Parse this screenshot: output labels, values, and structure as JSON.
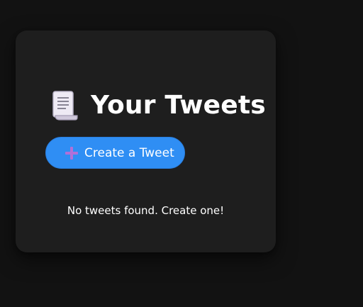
{
  "header": {
    "icon": "scroll-icon",
    "title": "Your Tweets"
  },
  "actions": {
    "create_icon": "plus-icon",
    "create_label": "Create a Tweet"
  },
  "content": {
    "empty_message": "No tweets found. Create one!"
  },
  "colors": {
    "page_bg": "#121212",
    "card_bg": "#1e1e1e",
    "button_bg": "#2f8ef4",
    "plus_icon": "#b070d8",
    "text": "#ffffff"
  }
}
